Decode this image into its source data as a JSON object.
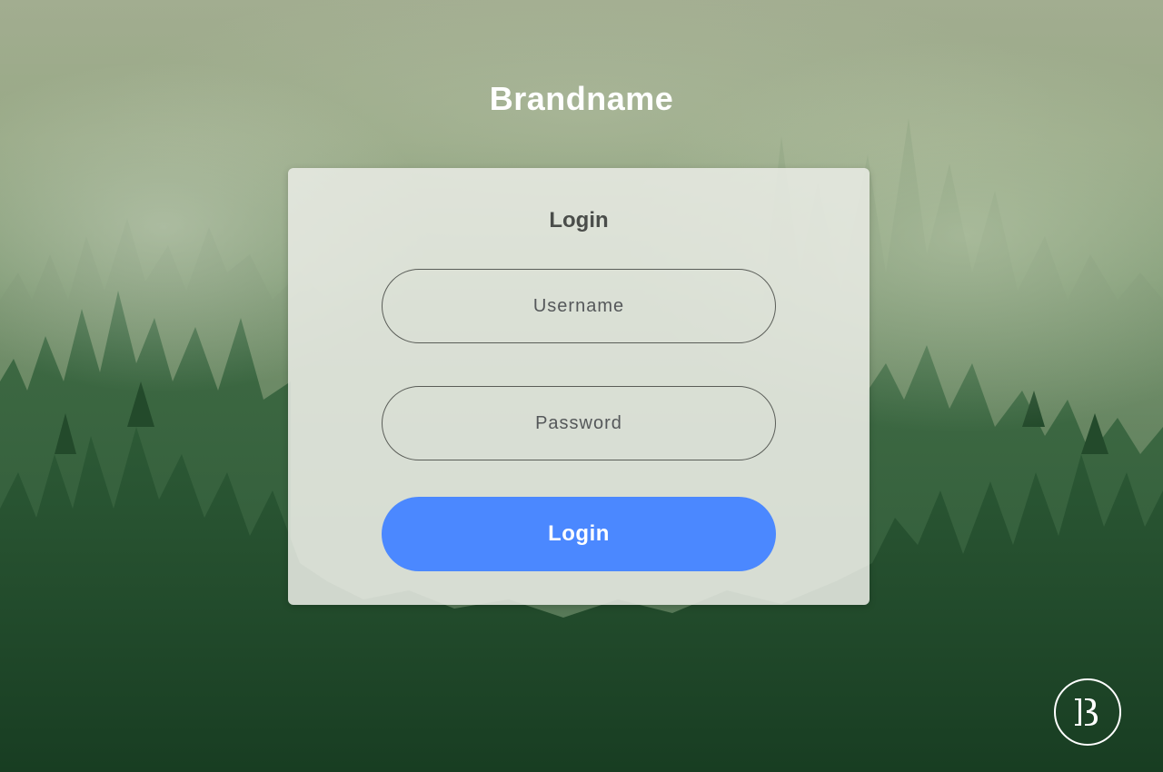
{
  "brand": {
    "name": "Brandname"
  },
  "login_card": {
    "title": "Login",
    "username_placeholder": "Username",
    "password_placeholder": "Password",
    "submit_label": "Login"
  },
  "logo": {
    "icon": "brand-b-logo-icon"
  },
  "colors": {
    "accent": "#4b88ff",
    "card_background": "#e8eae4",
    "text_white": "#ffffff",
    "text_dark": "#4a4d4a"
  }
}
